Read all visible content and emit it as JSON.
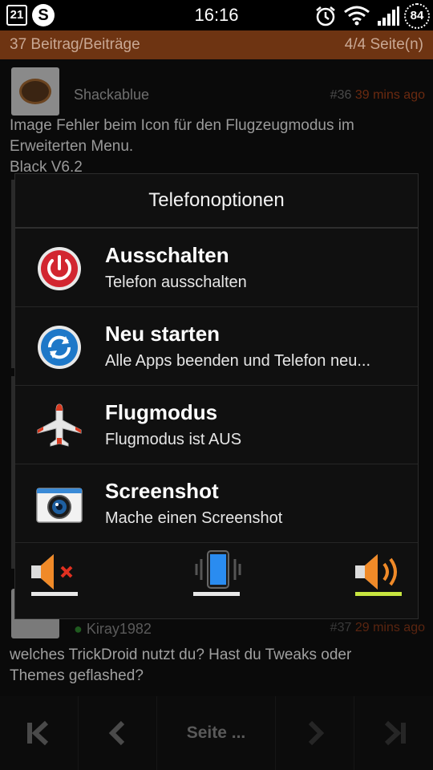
{
  "status_bar": {
    "date": "21",
    "app_badge": "S",
    "time": "16:16",
    "battery": "84",
    "icons": [
      "calendar-icon",
      "s-app-icon",
      "alarm-icon",
      "wifi-icon",
      "signal-icon",
      "battery-icon"
    ]
  },
  "header": {
    "posts": "37 Beitrag/Beiträge",
    "pages": "4/4 Seite(n)"
  },
  "posts": [
    {
      "user": "Shackablue",
      "number": "#36",
      "ago": "39 mins ago",
      "text": "Image Fehler beim Icon für den Flugzeugmodus im\nErweiterten Menu.\nBlack V6.2"
    },
    {
      "user": "Kiray1982",
      "number": "#37",
      "ago": "29 mins ago",
      "text": "welches TrickDroid nutzt du? Hast du Tweaks oder\nThemes geflashed?"
    }
  ],
  "dialog": {
    "title": "Telefonoptionen",
    "options": [
      {
        "title": "Ausschalten",
        "subtitle": "Telefon ausschalten",
        "icon": "power-icon"
      },
      {
        "title": "Neu starten",
        "subtitle": "Alle Apps beenden und Telefon neu...",
        "icon": "restart-icon"
      },
      {
        "title": "Flugmodus",
        "subtitle": "Flugmodus ist AUS",
        "icon": "airplane-icon"
      },
      {
        "title": "Screenshot",
        "subtitle": "Mache einen Screenshot",
        "icon": "camera-icon"
      }
    ],
    "sound_modes": [
      {
        "name": "mute",
        "icon": "speaker-mute-icon",
        "active": false
      },
      {
        "name": "vibrate",
        "icon": "phone-vibrate-icon",
        "active": false
      },
      {
        "name": "sound",
        "icon": "speaker-sound-icon",
        "active": true
      }
    ]
  },
  "bottom_nav": {
    "page_label": "Seite ..."
  },
  "colors": {
    "header_bg": "#6e3412",
    "active_indicator": "#c8e640",
    "power_red": "#d22630",
    "restart_blue": "#1e78c8"
  }
}
